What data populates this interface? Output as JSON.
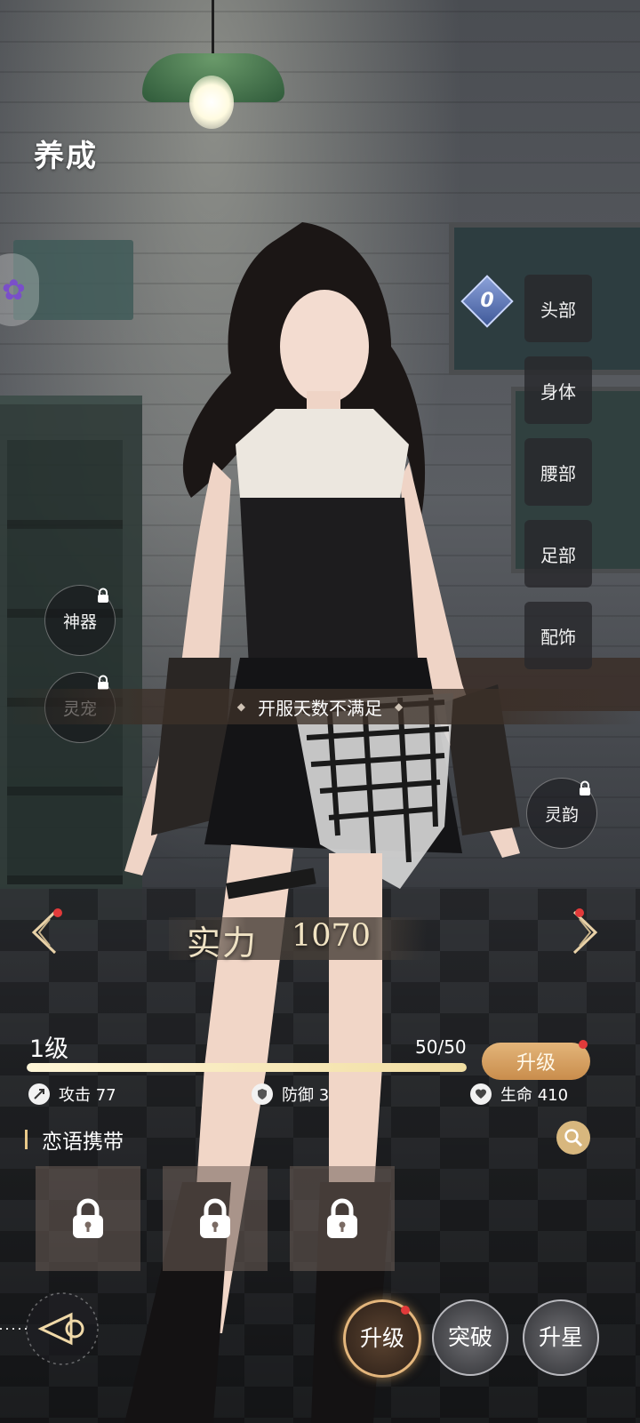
{
  "header": {
    "title": "养成"
  },
  "slot_badge": {
    "value": "0"
  },
  "equipment_parts": [
    "头部",
    "身体",
    "腰部",
    "足部",
    "配饰"
  ],
  "side_buttons": {
    "artifact": "神器",
    "pet": "灵宠",
    "charm": "灵韵"
  },
  "toast": {
    "message": "开服天数不满足"
  },
  "power": {
    "label": "实力",
    "value": "1070"
  },
  "level": {
    "label": "1级",
    "exp": "50/50",
    "exp_fraction": 1.0,
    "upgrade_label": "升级"
  },
  "stats": {
    "attack": "攻击 77",
    "defense": "防御 3",
    "hp": "生命 410"
  },
  "love_words": {
    "title": "恋语携带",
    "slots": 3
  },
  "bottom_tabs": [
    "升级",
    "突破",
    "升星"
  ],
  "colors": {
    "accent": "#d8b77e",
    "upgrade": "#c98d4c",
    "notice_dot": "#e23a3a"
  }
}
